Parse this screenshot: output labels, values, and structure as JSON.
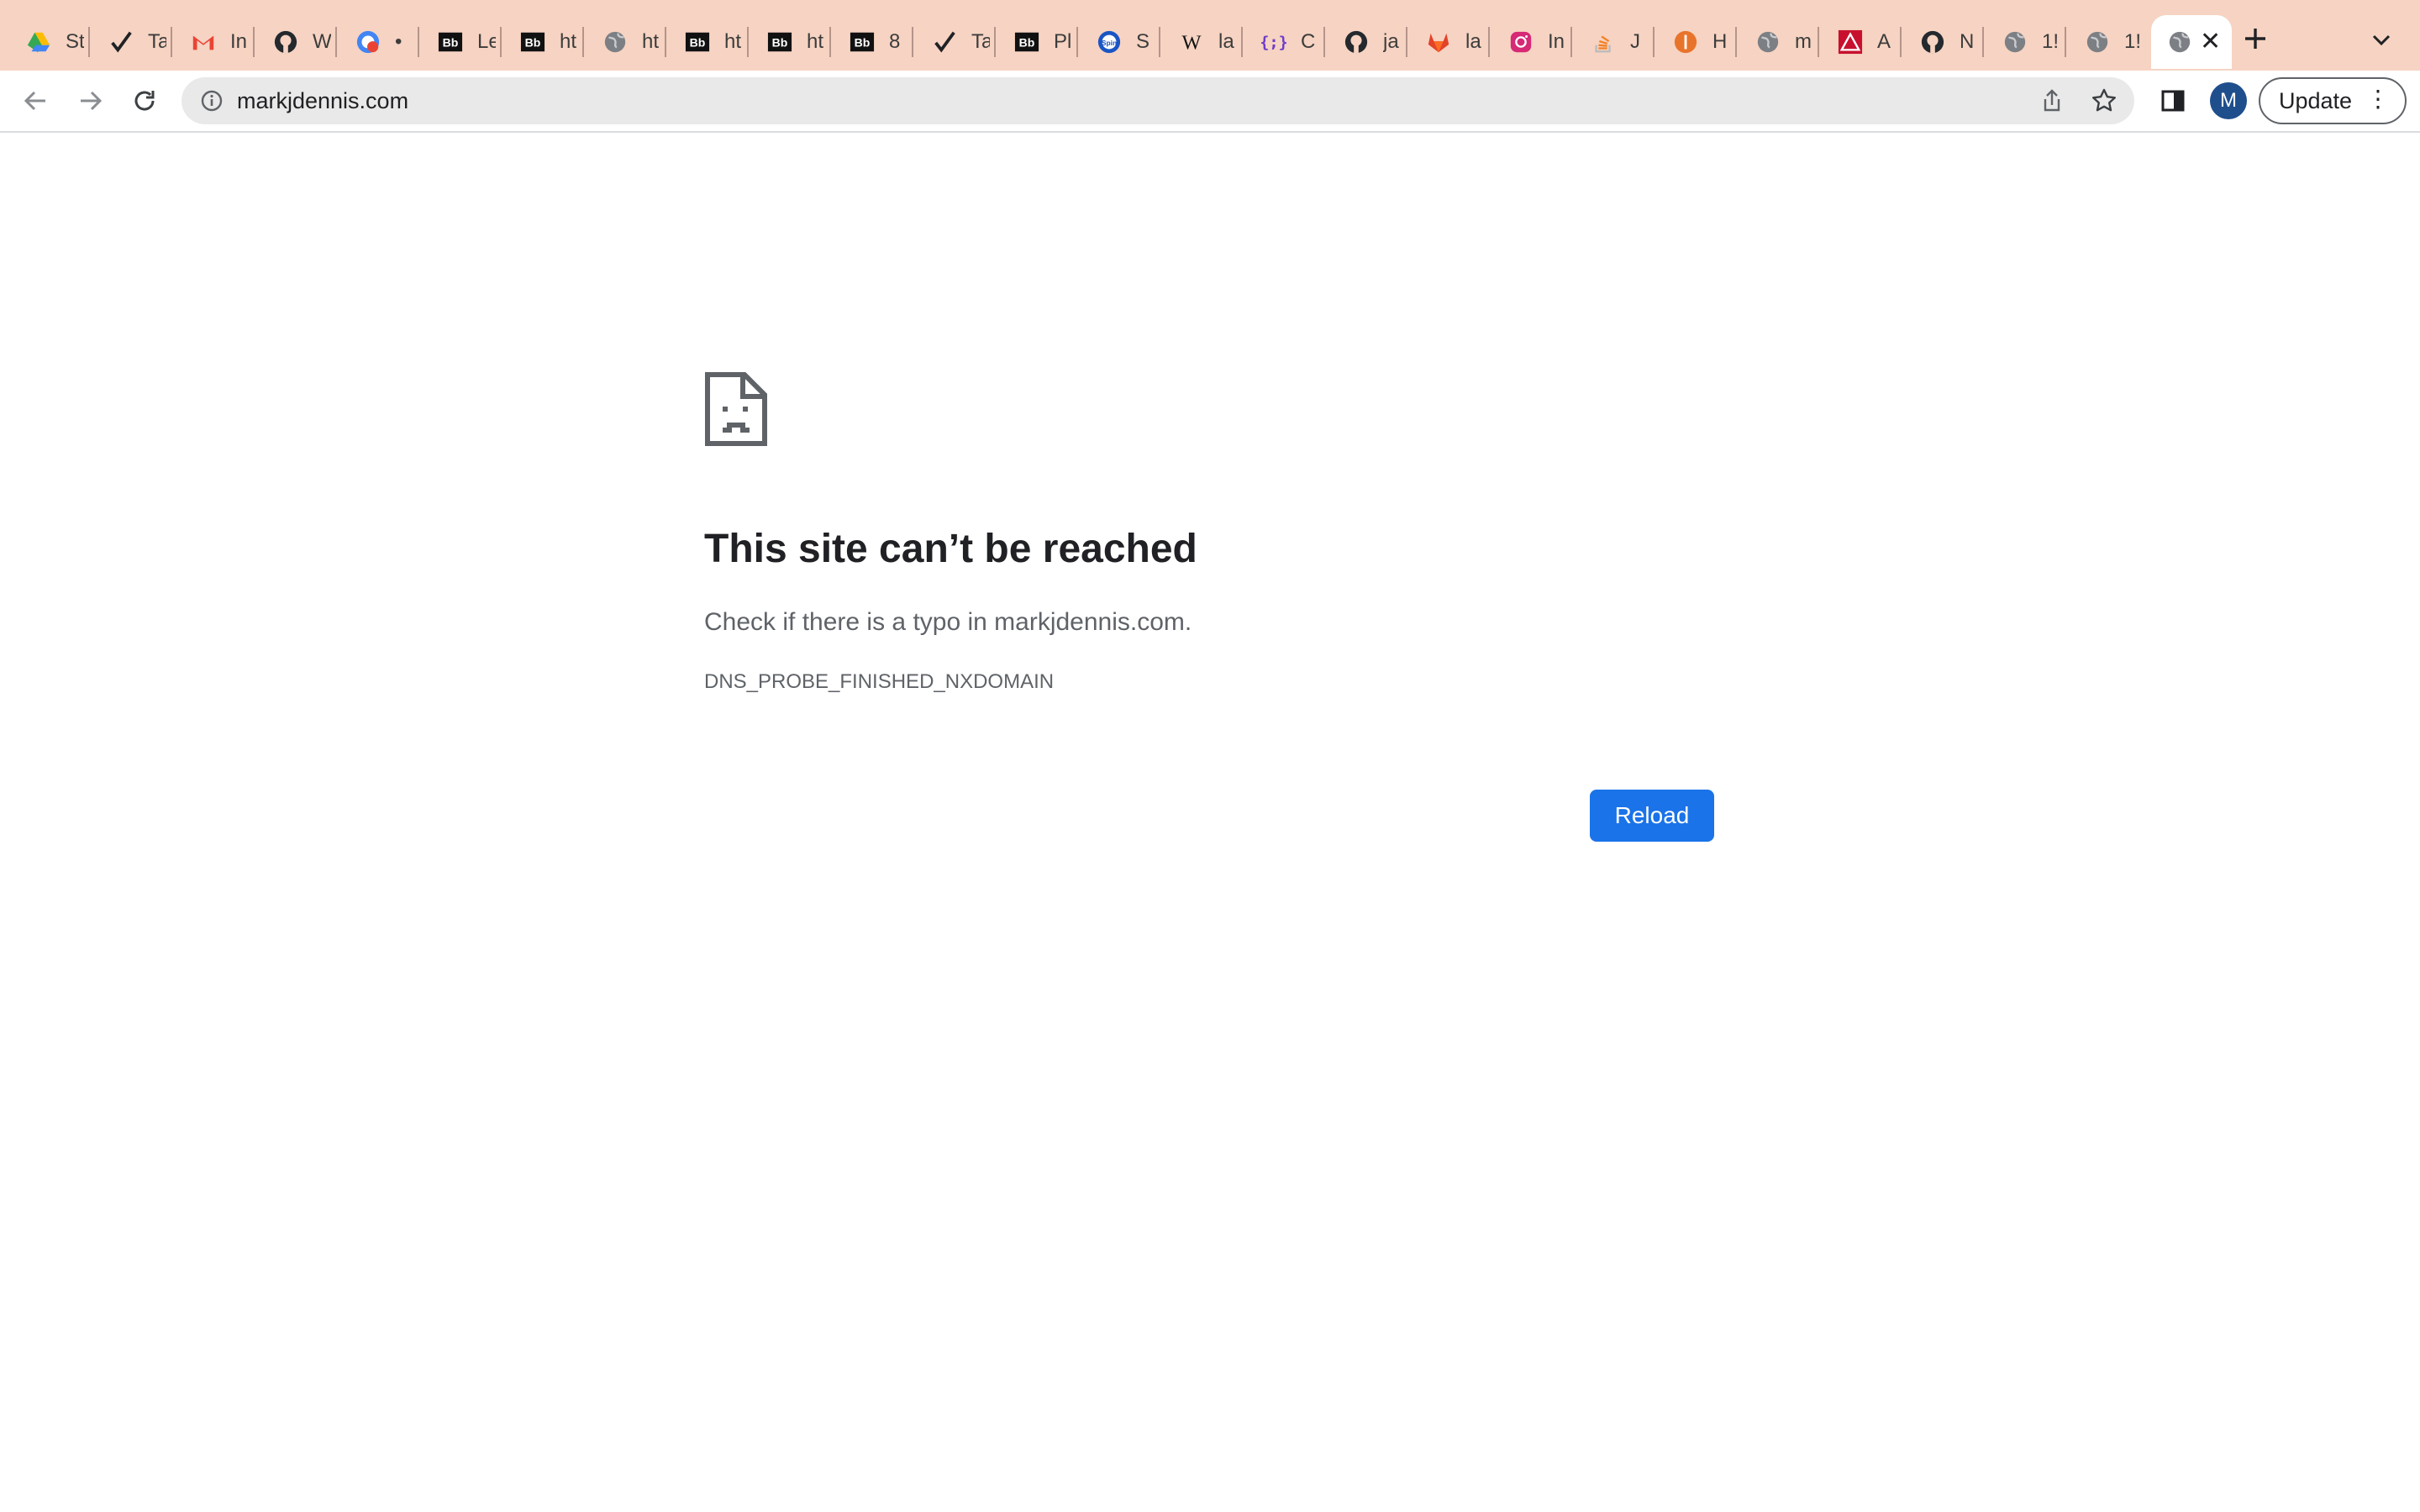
{
  "browser": {
    "tabs": [
      {
        "favicon": "google-drive-icon",
        "title": "St"
      },
      {
        "favicon": "checkmark-icon",
        "title": "Ta"
      },
      {
        "favicon": "gmail-icon",
        "title": "In"
      },
      {
        "favicon": "github-icon",
        "title": "W"
      },
      {
        "favicon": "recording-icon",
        "title": "•"
      },
      {
        "favicon": "blackboard-icon",
        "title": "Le"
      },
      {
        "favicon": "blackboard-icon",
        "title": "ht"
      },
      {
        "favicon": "globe-icon",
        "title": "ht"
      },
      {
        "favicon": "blackboard-icon",
        "title": "ht"
      },
      {
        "favicon": "blackboard-icon",
        "title": "ht"
      },
      {
        "favicon": "blackboard-icon",
        "title": "8"
      },
      {
        "favicon": "checkmark-icon",
        "title": "Ta"
      },
      {
        "favicon": "blackboard-icon",
        "title": "Pl"
      },
      {
        "favicon": "spin-icon",
        "title": "S"
      },
      {
        "favicon": "wikipedia-icon",
        "title": "la"
      },
      {
        "favicon": "code-brackets-icon",
        "title": "C"
      },
      {
        "favicon": "github-icon",
        "title": "ja"
      },
      {
        "favicon": "gitlab-icon",
        "title": "la"
      },
      {
        "favicon": "instagram-icon",
        "title": "In"
      },
      {
        "favicon": "stackoverflow-icon",
        "title": "J"
      },
      {
        "favicon": "shield-orange-icon",
        "title": "H"
      },
      {
        "favicon": "globe-icon",
        "title": "m"
      },
      {
        "favicon": "warning-icon",
        "title": "A"
      },
      {
        "favicon": "github-icon",
        "title": "N"
      },
      {
        "favicon": "globe-icon",
        "title": "1!"
      },
      {
        "favicon": "globe-icon",
        "title": "1!"
      }
    ],
    "active_tab": {
      "favicon": "globe-icon",
      "close_label": "✕"
    },
    "new_tab_label": "+",
    "url": "markjdennis.com",
    "avatar_letter": "M",
    "update_label": "Update",
    "menu_label": "⋮"
  },
  "error_page": {
    "title": "This site can’t be reached",
    "suggestion": "Check if there is a typo in markjdennis.com.",
    "error_code": "DNS_PROBE_FINISHED_NXDOMAIN",
    "reload_label": "Reload"
  },
  "colors": {
    "tabstrip": "#f6d3c2",
    "omnibox": "#e9e9e9",
    "reload_button": "#1a73e8",
    "avatar": "#1f4e8c"
  }
}
